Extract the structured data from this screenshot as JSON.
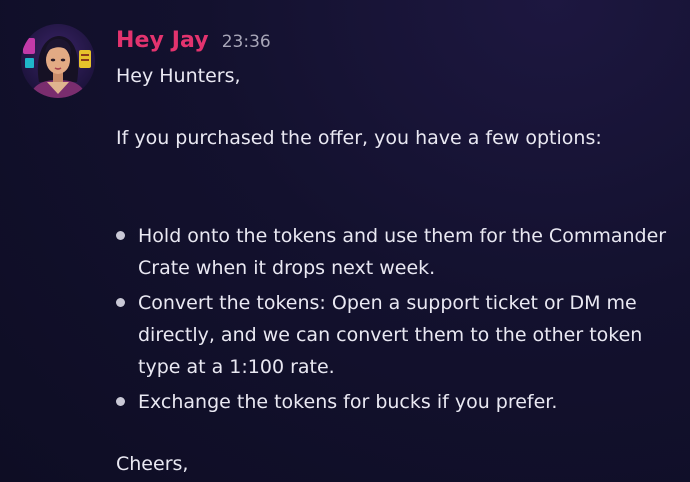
{
  "message": {
    "author": "Hey Jay",
    "timestamp": "23:36",
    "greeting": "Hey Hunters,",
    "intro": "If you purchased the offer, you have a few options:",
    "options": [
      {
        "lines": [
          "Hold onto the tokens and use them for the Commander",
          "Crate when it drops next week."
        ]
      },
      {
        "lines": [
          "Convert the tokens: Open a support ticket or DM me",
          "directly, and we can convert them to the other token",
          "type at a 1:100 rate."
        ]
      },
      {
        "lines": [
          "Exchange the tokens for bucks if you prefer."
        ]
      }
    ],
    "closing": "Cheers,"
  },
  "colors": {
    "author": "#e3336e",
    "background": "#13112e",
    "text": "#e9e8f2",
    "timestamp": "#a8a6b8"
  },
  "icons": {
    "avatar": "user-avatar-illustration",
    "bullet": "bullet-dot-icon"
  }
}
